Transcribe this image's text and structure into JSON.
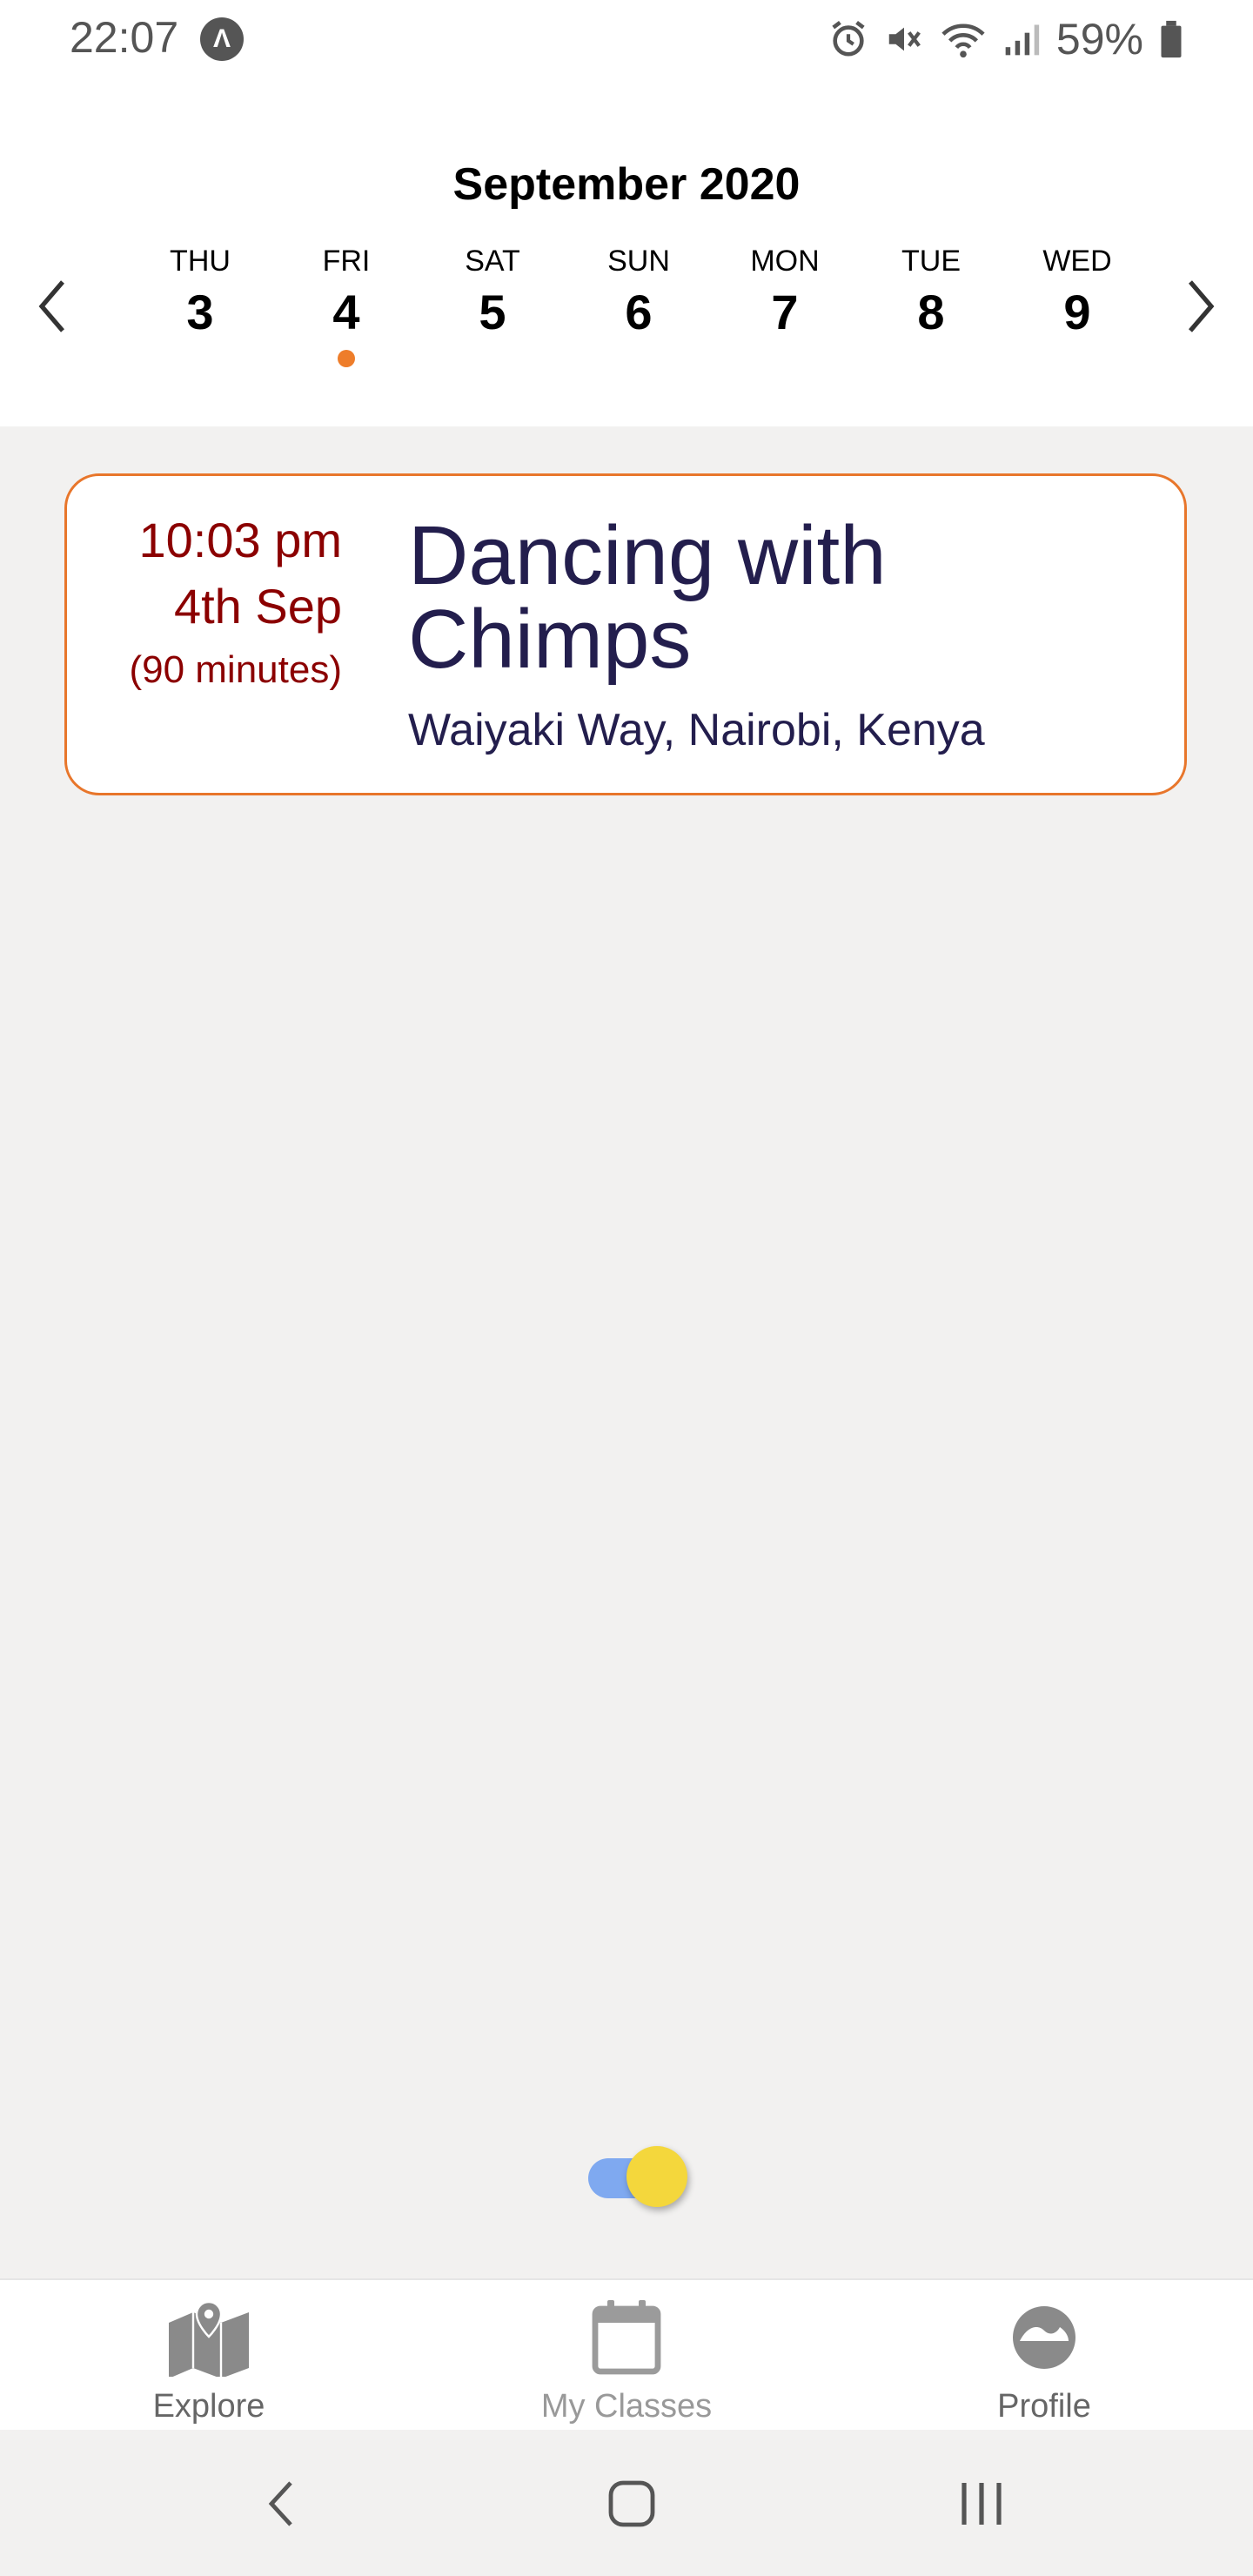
{
  "status_bar": {
    "time": "22:07",
    "app_badge": "Λ",
    "battery": "59%"
  },
  "calendar": {
    "month": "September 2020",
    "days": [
      {
        "name": "THU",
        "num": "3"
      },
      {
        "name": "FRI",
        "num": "4",
        "has_event": true
      },
      {
        "name": "SAT",
        "num": "5"
      },
      {
        "name": "SUN",
        "num": "6"
      },
      {
        "name": "MON",
        "num": "7"
      },
      {
        "name": "TUE",
        "num": "8"
      },
      {
        "name": "WED",
        "num": "9"
      }
    ],
    "event_dot_color": "#ee7d2a"
  },
  "class_card": {
    "time": "10:03 pm",
    "date": "4th Sep",
    "duration": "(90 minutes)",
    "title": "Dancing with Chimps",
    "location": "Waiyaki Way, Nairobi, Kenya",
    "border_color": "#e8762b",
    "time_color": "#8b0000",
    "title_color": "#231e4d"
  },
  "toggle": {
    "state": "on",
    "track_color": "#7fa9f0",
    "thumb_color": "#f4d73c"
  },
  "tabs": [
    {
      "label": "Explore",
      "icon": "map-icon"
    },
    {
      "label": "My Classes",
      "icon": "calendar-icon"
    },
    {
      "label": "Profile",
      "icon": "profile-icon"
    }
  ],
  "system_nav": [
    "back-icon",
    "home-icon",
    "recents-icon"
  ]
}
